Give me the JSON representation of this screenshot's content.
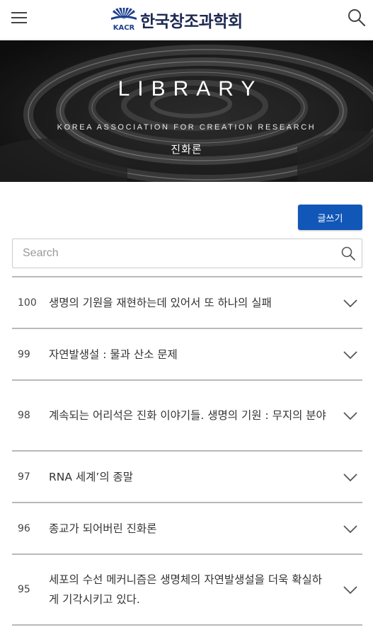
{
  "header": {
    "logo_text": "한국창조과학회",
    "logo_mark_text": "KACR"
  },
  "banner": {
    "title": "LIBRARY",
    "subtitle": "KOREA  ASSOCIATION FOR CREATION RESEARCH",
    "category": "진화론"
  },
  "toolbar": {
    "write_label": "글쓰기"
  },
  "search": {
    "placeholder": "Search",
    "value": ""
  },
  "posts": [
    {
      "number": "100",
      "title": "생명의 기원을 재현하는데 있어서 또 하나의 실패"
    },
    {
      "number": "99",
      "title": "자연발생설 : 물과 산소 문제"
    },
    {
      "number": "98",
      "title": "계속되는 어리석은 진화 이야기들. 생명의 기원 : 무지의 분야"
    },
    {
      "number": "97",
      "title": "RNA 세계’의 종말"
    },
    {
      "number": "96",
      "title": "종교가 되어버린 진화론"
    },
    {
      "number": "95",
      "title": "세포의 수선 메커니즘은 생명체의 자연발생설을 더욱 확실하게 기각시키고 있다."
    }
  ],
  "icons": {
    "menu": "hamburger-menu-icon",
    "search": "search-icon",
    "expand": "chevron-down-icon"
  },
  "colors": {
    "accent": "#1157b8",
    "logo": "#1d2a52",
    "divider": "#b9b9b9"
  }
}
